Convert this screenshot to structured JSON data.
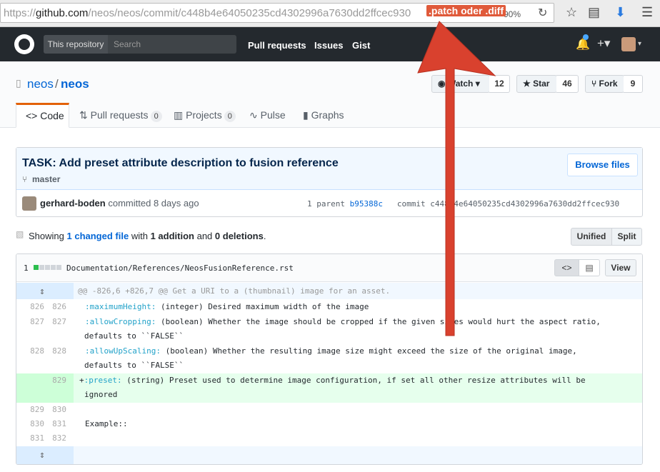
{
  "browser": {
    "url_prefix": "https://",
    "url_host": "github.com",
    "url_path": "/neos/neos/commit/c448b4e64050235cd4302996a7630dd2ffcec930",
    "annotation": ".patch oder .diff",
    "zoom": "90%"
  },
  "header": {
    "scope_label": "This repository",
    "search_placeholder": "Search",
    "nav": [
      "Pull requests",
      "Issues",
      "Gist"
    ]
  },
  "repo": {
    "owner": "neos",
    "separator": "/",
    "name": "neos",
    "watch_label": "Watch",
    "watch_count": "12",
    "star_label": "Star",
    "star_count": "46",
    "fork_label": "Fork",
    "fork_count": "9"
  },
  "tabs": [
    {
      "label": "Code"
    },
    {
      "label": "Pull requests",
      "count": "0"
    },
    {
      "label": "Projects",
      "count": "0"
    },
    {
      "label": "Pulse"
    },
    {
      "label": "Graphs"
    }
  ],
  "commit": {
    "title": "TASK: Add preset attribute description to fusion reference",
    "branch": "master",
    "browse_label": "Browse files",
    "author": "gerhard-boden",
    "action": "committed",
    "when": "8 days ago",
    "parent_label": "1 parent",
    "parent_sha": "b95388c",
    "commit_label": "commit",
    "commit_sha": "c448b4e64050235cd4302996a7630dd2ffcec930"
  },
  "summary": {
    "showing": "Showing",
    "changed": "1 changed file",
    "with": "with",
    "additions": "1 addition",
    "and": "and",
    "deletions": "0 deletions",
    "end": ".",
    "unified": "Unified",
    "split": "Split"
  },
  "file": {
    "count": "1",
    "path": "Documentation/References/NeosFusionReference.rst",
    "view_label": "View"
  },
  "diff": {
    "hunk": "@@ -826,6 +826,7 @@ Get a URI to a (thumbnail) image for an asset.",
    "rows": [
      {
        "old": "826",
        "new": "826",
        "key": ":maximumHeight:",
        "text": " (integer) Desired maximum width of the image"
      },
      {
        "old": "827",
        "new": "827",
        "key": ":allowCropping:",
        "text": " (boolean) Whether the image should be cropped if the given sizes would hurt the aspect ratio,",
        "cont": "defaults to ``FALSE``"
      },
      {
        "old": "828",
        "new": "828",
        "key": ":allowUpScaling:",
        "text": " (boolean) Whether the resulting image size might exceed the size of the original image,",
        "cont": "defaults to ``FALSE``"
      },
      {
        "old": "",
        "new": "829",
        "prefix": "+",
        "key": ":preset:",
        "text": " (string) Preset used to determine image configuration, if set all other resize attributes will be",
        "cont": "ignored"
      },
      {
        "old": "829",
        "new": "830",
        "text": ""
      },
      {
        "old": "830",
        "new": "831",
        "text": "Example::"
      },
      {
        "old": "831",
        "new": "832",
        "text": ""
      }
    ]
  },
  "colors": {
    "arrow": "#d9412e",
    "header": "#24292e",
    "link": "#0366d6"
  }
}
